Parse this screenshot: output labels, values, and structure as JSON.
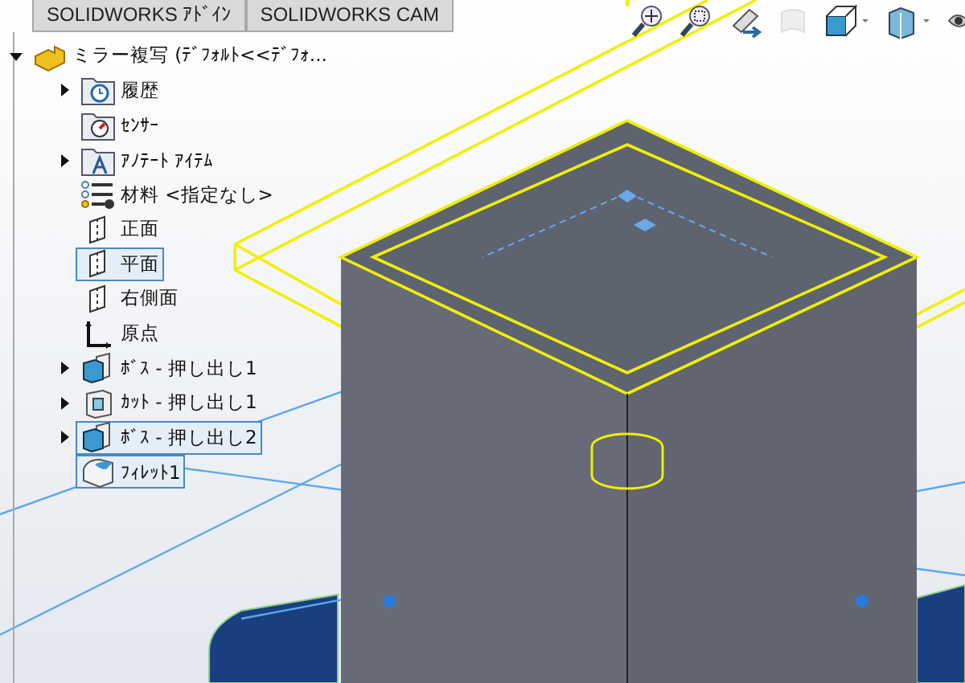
{
  "tabs": [
    {
      "label": "SOLIDWORKS ｱﾄﾞｲﾝ",
      "selected": false
    },
    {
      "label": "SOLIDWORKS CAM",
      "selected": false
    }
  ],
  "feature_tree": {
    "root": {
      "label": "ミラー複写 (ﾃﾞﾌｫﾙﾄ<<ﾃﾞﾌｫ...",
      "kind": "part",
      "expanded": true,
      "children": [
        {
          "label": "履歴",
          "kind": "history",
          "expandable": true,
          "selected": false
        },
        {
          "label": "ｾﾝｻｰ",
          "kind": "sensor",
          "expandable": false,
          "selected": false
        },
        {
          "label": "ｱﾉﾃｰﾄ ｱｲﾃﾑ",
          "kind": "annotation",
          "expandable": true,
          "selected": false
        },
        {
          "label": "材料 <指定なし>",
          "kind": "material",
          "expandable": false,
          "selected": false
        },
        {
          "label": "正面",
          "kind": "plane",
          "expandable": false,
          "selected": false
        },
        {
          "label": "平面",
          "kind": "plane",
          "expandable": false,
          "selected": true
        },
        {
          "label": "右側面",
          "kind": "plane",
          "expandable": false,
          "selected": false
        },
        {
          "label": "原点",
          "kind": "origin",
          "expandable": false,
          "selected": false
        },
        {
          "label": "ﾎﾞｽ - 押し出し1",
          "kind": "boss",
          "expandable": true,
          "selected": false
        },
        {
          "label": "ｶｯﾄ - 押し出し1",
          "kind": "cut",
          "expandable": true,
          "selected": false
        },
        {
          "label": "ﾎﾞｽ - 押し出し2",
          "kind": "boss",
          "expandable": true,
          "selected": true
        },
        {
          "label": "ﾌｨﾚｯﾄ1",
          "kind": "fillet",
          "expandable": false,
          "selected": true
        }
      ]
    }
  },
  "toolbar": [
    {
      "kind": "zoom-fit",
      "disabled": false
    },
    {
      "kind": "zoom-area",
      "disabled": false
    },
    {
      "kind": "previous-view",
      "disabled": false
    },
    {
      "kind": "section-view",
      "disabled": true
    },
    {
      "kind": "view-orientation",
      "disabled": false
    },
    {
      "kind": "display-style",
      "disabled": false
    },
    {
      "kind": "hide-show",
      "disabled": false
    }
  ]
}
